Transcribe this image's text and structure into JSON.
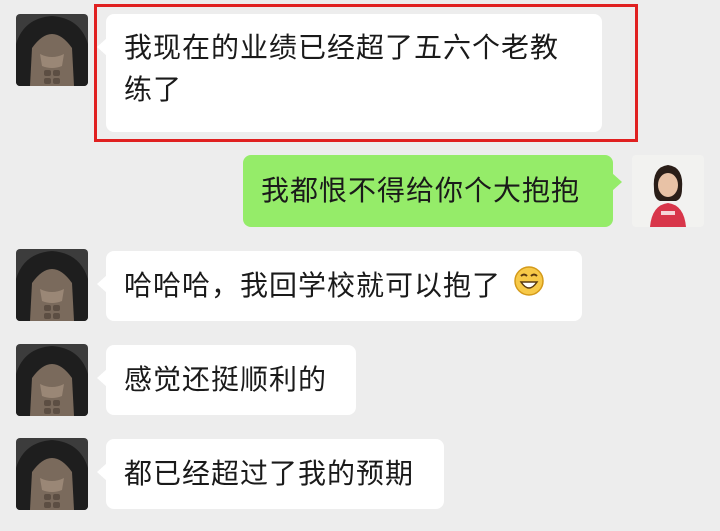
{
  "messages": [
    {
      "side": "left",
      "text_line1": "我现在的业绩已经超了五六个老教",
      "text_line2": "练了",
      "highlighted": true
    },
    {
      "side": "right",
      "text": "我都恨不得给你个大抱抱"
    },
    {
      "side": "left",
      "text": "哈哈哈，我回学校就可以抱了",
      "emoji": "grinning-face-emoji"
    },
    {
      "side": "left",
      "text": "感觉还挺顺利的"
    },
    {
      "side": "left",
      "text": "都已经超过了我的预期"
    }
  ],
  "colors": {
    "background": "#ededed",
    "incoming_bubble": "#ffffff",
    "outgoing_bubble": "#95ec69",
    "highlight_border": "#e02020"
  },
  "icons": {
    "contact_avatar": "muscle-torso-hoodie-avatar",
    "self_avatar": "woman-portrait-avatar"
  }
}
